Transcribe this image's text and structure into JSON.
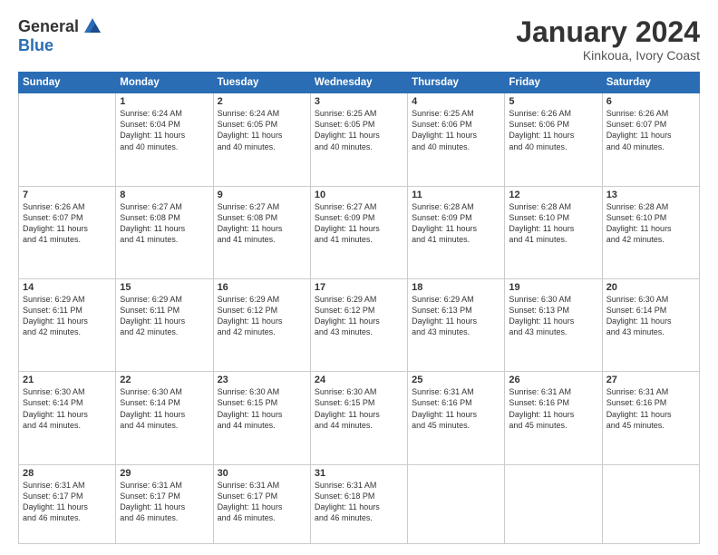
{
  "logo": {
    "general": "General",
    "blue": "Blue"
  },
  "header": {
    "title": "January 2024",
    "subtitle": "Kinkoua, Ivory Coast"
  },
  "weekdays": [
    "Sunday",
    "Monday",
    "Tuesday",
    "Wednesday",
    "Thursday",
    "Friday",
    "Saturday"
  ],
  "weeks": [
    [
      {
        "day": "",
        "info": ""
      },
      {
        "day": "1",
        "info": "Sunrise: 6:24 AM\nSunset: 6:04 PM\nDaylight: 11 hours\nand 40 minutes."
      },
      {
        "day": "2",
        "info": "Sunrise: 6:24 AM\nSunset: 6:05 PM\nDaylight: 11 hours\nand 40 minutes."
      },
      {
        "day": "3",
        "info": "Sunrise: 6:25 AM\nSunset: 6:05 PM\nDaylight: 11 hours\nand 40 minutes."
      },
      {
        "day": "4",
        "info": "Sunrise: 6:25 AM\nSunset: 6:06 PM\nDaylight: 11 hours\nand 40 minutes."
      },
      {
        "day": "5",
        "info": "Sunrise: 6:26 AM\nSunset: 6:06 PM\nDaylight: 11 hours\nand 40 minutes."
      },
      {
        "day": "6",
        "info": "Sunrise: 6:26 AM\nSunset: 6:07 PM\nDaylight: 11 hours\nand 40 minutes."
      }
    ],
    [
      {
        "day": "7",
        "info": "Sunrise: 6:26 AM\nSunset: 6:07 PM\nDaylight: 11 hours\nand 41 minutes."
      },
      {
        "day": "8",
        "info": "Sunrise: 6:27 AM\nSunset: 6:08 PM\nDaylight: 11 hours\nand 41 minutes."
      },
      {
        "day": "9",
        "info": "Sunrise: 6:27 AM\nSunset: 6:08 PM\nDaylight: 11 hours\nand 41 minutes."
      },
      {
        "day": "10",
        "info": "Sunrise: 6:27 AM\nSunset: 6:09 PM\nDaylight: 11 hours\nand 41 minutes."
      },
      {
        "day": "11",
        "info": "Sunrise: 6:28 AM\nSunset: 6:09 PM\nDaylight: 11 hours\nand 41 minutes."
      },
      {
        "day": "12",
        "info": "Sunrise: 6:28 AM\nSunset: 6:10 PM\nDaylight: 11 hours\nand 41 minutes."
      },
      {
        "day": "13",
        "info": "Sunrise: 6:28 AM\nSunset: 6:10 PM\nDaylight: 11 hours\nand 42 minutes."
      }
    ],
    [
      {
        "day": "14",
        "info": "Sunrise: 6:29 AM\nSunset: 6:11 PM\nDaylight: 11 hours\nand 42 minutes."
      },
      {
        "day": "15",
        "info": "Sunrise: 6:29 AM\nSunset: 6:11 PM\nDaylight: 11 hours\nand 42 minutes."
      },
      {
        "day": "16",
        "info": "Sunrise: 6:29 AM\nSunset: 6:12 PM\nDaylight: 11 hours\nand 42 minutes."
      },
      {
        "day": "17",
        "info": "Sunrise: 6:29 AM\nSunset: 6:12 PM\nDaylight: 11 hours\nand 43 minutes."
      },
      {
        "day": "18",
        "info": "Sunrise: 6:29 AM\nSunset: 6:13 PM\nDaylight: 11 hours\nand 43 minutes."
      },
      {
        "day": "19",
        "info": "Sunrise: 6:30 AM\nSunset: 6:13 PM\nDaylight: 11 hours\nand 43 minutes."
      },
      {
        "day": "20",
        "info": "Sunrise: 6:30 AM\nSunset: 6:14 PM\nDaylight: 11 hours\nand 43 minutes."
      }
    ],
    [
      {
        "day": "21",
        "info": "Sunrise: 6:30 AM\nSunset: 6:14 PM\nDaylight: 11 hours\nand 44 minutes."
      },
      {
        "day": "22",
        "info": "Sunrise: 6:30 AM\nSunset: 6:14 PM\nDaylight: 11 hours\nand 44 minutes."
      },
      {
        "day": "23",
        "info": "Sunrise: 6:30 AM\nSunset: 6:15 PM\nDaylight: 11 hours\nand 44 minutes."
      },
      {
        "day": "24",
        "info": "Sunrise: 6:30 AM\nSunset: 6:15 PM\nDaylight: 11 hours\nand 44 minutes."
      },
      {
        "day": "25",
        "info": "Sunrise: 6:31 AM\nSunset: 6:16 PM\nDaylight: 11 hours\nand 45 minutes."
      },
      {
        "day": "26",
        "info": "Sunrise: 6:31 AM\nSunset: 6:16 PM\nDaylight: 11 hours\nand 45 minutes."
      },
      {
        "day": "27",
        "info": "Sunrise: 6:31 AM\nSunset: 6:16 PM\nDaylight: 11 hours\nand 45 minutes."
      }
    ],
    [
      {
        "day": "28",
        "info": "Sunrise: 6:31 AM\nSunset: 6:17 PM\nDaylight: 11 hours\nand 46 minutes."
      },
      {
        "day": "29",
        "info": "Sunrise: 6:31 AM\nSunset: 6:17 PM\nDaylight: 11 hours\nand 46 minutes."
      },
      {
        "day": "30",
        "info": "Sunrise: 6:31 AM\nSunset: 6:17 PM\nDaylight: 11 hours\nand 46 minutes."
      },
      {
        "day": "31",
        "info": "Sunrise: 6:31 AM\nSunset: 6:18 PM\nDaylight: 11 hours\nand 46 minutes."
      },
      {
        "day": "",
        "info": ""
      },
      {
        "day": "",
        "info": ""
      },
      {
        "day": "",
        "info": ""
      }
    ]
  ]
}
